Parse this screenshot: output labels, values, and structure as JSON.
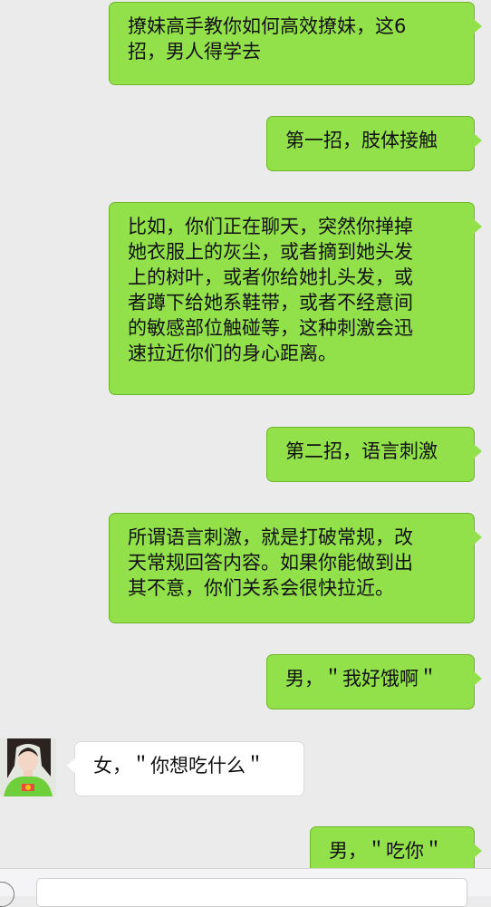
{
  "messages": [
    {
      "id": "m1",
      "side": "out",
      "text": "撩妹高手教你如何高效撩妹，这6\n招，男人得学去"
    },
    {
      "id": "m2",
      "side": "out",
      "text": "第一招，肢体接触"
    },
    {
      "id": "m3",
      "side": "out",
      "text": "比如，你们正在聊天，突然你掸掉\n她衣服上的灰尘，或者摘到她头发\n上的树叶，或者你给她扎头发，或\n者蹲下给她系鞋带，或者不经意间\n的敏感部位触碰等，这种刺激会迅\n速拉近你们的身心距离。"
    },
    {
      "id": "m4",
      "side": "out",
      "text": "第二招，语言刺激"
    },
    {
      "id": "m5",
      "side": "out",
      "text": "所谓语言刺激，就是打破常规，改\n天常规回答内容。如果你能做到出\n其不意，你们关系会很快拉近。"
    },
    {
      "id": "m6",
      "side": "out",
      "text": "男，＂我好饿啊＂"
    },
    {
      "id": "m7",
      "side": "in",
      "text": "女，＂你想吃什么＂"
    },
    {
      "id": "m8",
      "side": "out",
      "text": "男，＂吃你＂"
    }
  ],
  "contact": {
    "avatar_icon": "contact-avatar"
  },
  "input_bar": {
    "voice_icon": "voice-input-icon",
    "text_value": ""
  },
  "colors": {
    "background": "#ebebeb",
    "outgoing_bubble": "#92e14b",
    "incoming_bubble": "#ffffff",
    "input_bar": "#f4f4f6"
  }
}
